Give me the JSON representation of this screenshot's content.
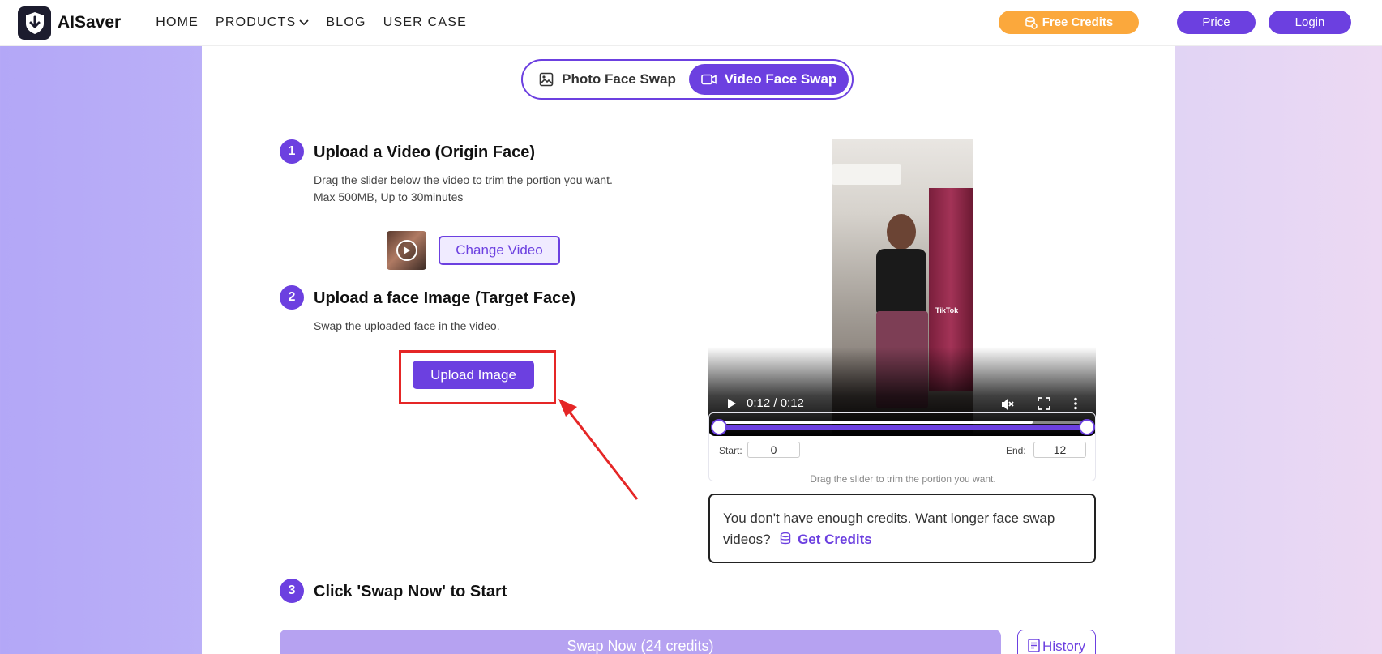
{
  "header": {
    "brand": "AISaver",
    "nav": [
      {
        "label": "HOME"
      },
      {
        "label": "PRODUCTS"
      },
      {
        "label": "BLOG"
      },
      {
        "label": "USER CASE"
      }
    ],
    "free_credits": "Free Credits",
    "price": "Price",
    "login": "Login"
  },
  "mode_tabs": {
    "photo": "Photo Face Swap",
    "video": "Video Face Swap",
    "active": "video"
  },
  "step1": {
    "number": "1",
    "title": "Upload a Video (Origin Face)",
    "desc_line1": "Drag the slider below the video to trim the portion you want.",
    "desc_line2": "Max 500MB, Up to 30minutes",
    "change_button": "Change Video"
  },
  "step2": {
    "number": "2",
    "title": "Upload a face Image (Target Face)",
    "desc": "Swap the uploaded face in the video.",
    "upload_button": "Upload Image"
  },
  "video_player": {
    "time": "0:12 / 0:12",
    "watermark": "TikTok",
    "progress": 0.86
  },
  "trim": {
    "start_label": "Start:",
    "start_value": "0",
    "end_label": "End:",
    "end_value": "12",
    "hint": "Drag the slider to trim the portion you want."
  },
  "credits_notice": {
    "text": "You don't have enough credits. Want longer face swap videos?",
    "link": "Get Credits"
  },
  "step3": {
    "number": "3",
    "title": "Click 'Swap Now' to Start",
    "swap_button": "Swap Now (24 credits)",
    "history_button": "History"
  },
  "colors": {
    "accent": "#6c40e0",
    "free_credits": "#fba83c",
    "highlight_frame": "#e52626"
  }
}
